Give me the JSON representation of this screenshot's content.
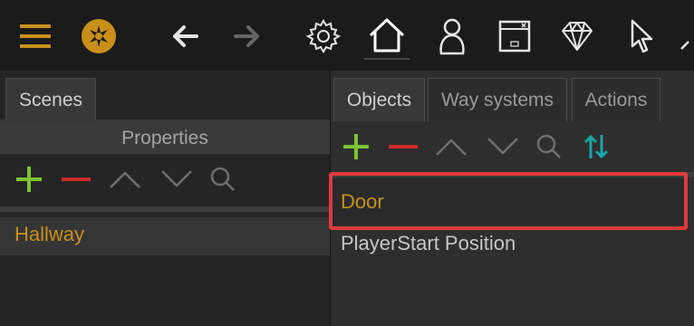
{
  "toolbar": {
    "items": [
      {
        "icon": "menu-icon"
      },
      {
        "icon": "logo-icon"
      },
      {
        "icon": "back-arrow-icon"
      },
      {
        "icon": "forward-arrow-icon"
      },
      {
        "icon": "gear-icon"
      },
      {
        "icon": "home-icon"
      },
      {
        "icon": "user-icon"
      },
      {
        "icon": "window-icon"
      },
      {
        "icon": "diamond-icon"
      },
      {
        "icon": "cursor-icon"
      }
    ]
  },
  "left_panel": {
    "tabs": [
      {
        "label": "Scenes"
      }
    ],
    "properties_label": "Properties",
    "list_items": [
      {
        "label": "Hallway"
      }
    ]
  },
  "right_panel": {
    "tabs": [
      {
        "label": "Objects"
      },
      {
        "label": "Way systems"
      },
      {
        "label": "Actions"
      }
    ],
    "list_items": [
      {
        "label": "Door",
        "selected": true
      },
      {
        "label": "PlayerStart Position",
        "selected": false
      }
    ]
  },
  "colors": {
    "accent_orange": "#c8901a",
    "add_green": "#7cc433",
    "remove_red": "#cc2a2a",
    "sort_teal": "#19a6a6",
    "highlight_red": "#e03a3a"
  }
}
